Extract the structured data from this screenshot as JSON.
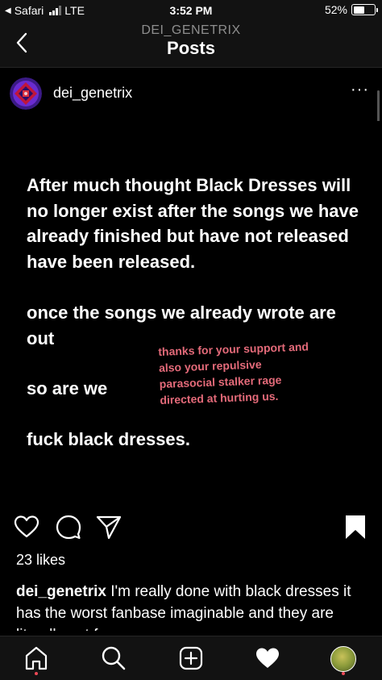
{
  "status_bar": {
    "carrier": "Safari",
    "network": "LTE",
    "time": "3:52 PM",
    "battery_percent": "52%",
    "battery_level": 0.52
  },
  "header": {
    "account": "DEI_GENETRIX",
    "title": "Posts"
  },
  "post": {
    "username": "dei_genetrix",
    "more_label": "···",
    "image_text": {
      "paragraph1": "After much thought Black Dresses will no longer exist after the songs we have already finished but have not released have been released.",
      "paragraph2": "once the songs we already wrote are out",
      "paragraph3": "so are we",
      "paragraph4": "fuck black dresses.",
      "overlay": "thanks for your support and also your repulsive parasocial stalker rage directed at hurting us."
    },
    "likes": "23 likes",
    "caption_username": "dei_genetrix",
    "caption_text": "I'm really done with black dresses it has the worst fanbase imaginable and they are literally out for my"
  },
  "icons": {
    "back": "chevron-left-icon",
    "like": "heart-outline-icon",
    "comment": "comment-icon",
    "share": "paper-plane-icon",
    "save": "bookmark-filled-icon",
    "home": "home-icon",
    "search": "search-icon",
    "new_post": "plus-square-icon",
    "activity": "heart-filled-icon"
  },
  "colors": {
    "background": "#000000",
    "bar_background": "#121212",
    "overlay_text": "#e36a79",
    "notification_dot": "#ed4956",
    "muted_text": "#8e8e8e"
  }
}
